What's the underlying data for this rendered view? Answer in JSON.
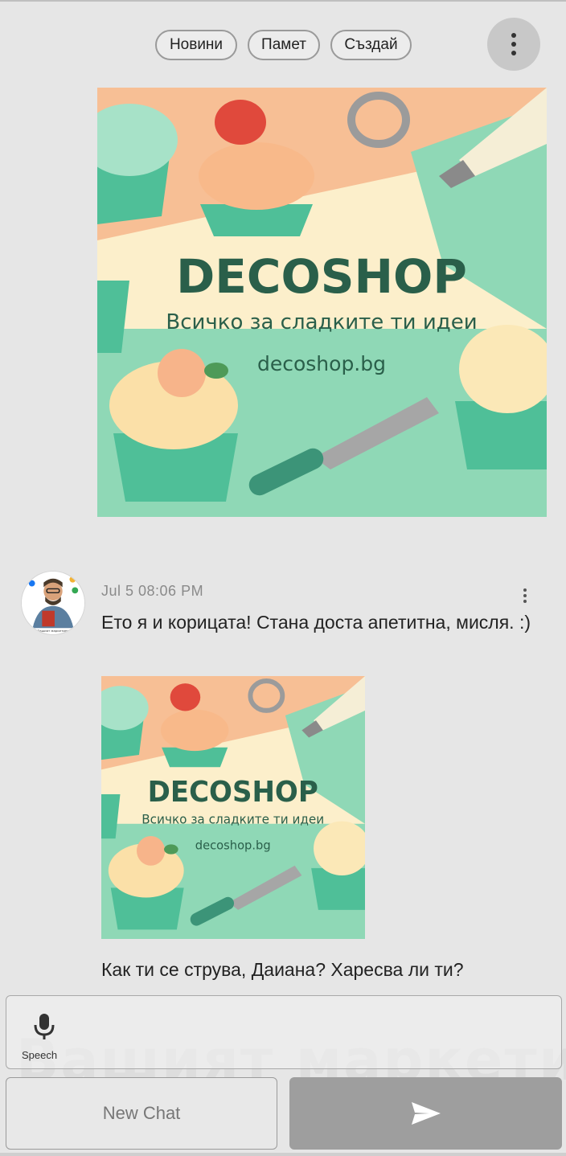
{
  "topbar": {
    "chips": [
      "Новини",
      "Памет",
      "Създай"
    ],
    "menu_icon": "more-vertical-icon"
  },
  "banner": {
    "brand": "DECOSHOP",
    "tagline": "Всичко за сладките ти идеи",
    "url": "decoshop.bg",
    "colors": {
      "peach": "#f7bf95",
      "cream": "#fcefcb",
      "mint": "#8fd8b6",
      "brand_text": "#2a5f4a"
    }
  },
  "message": {
    "timestamp": "Jul 5 08:06 PM",
    "text_1": "Ето я и корицата! Стана доста апетитна, мисля. :)",
    "text_2": "Как ти се струва, Даиана? Харесва ли ти?",
    "avatar_caption": "Вашият маркетинг"
  },
  "composer": {
    "speech_label": "Speech",
    "mic_icon": "microphone-icon"
  },
  "actions": {
    "new_chat_label": "New Chat",
    "send_icon": "send-icon"
  },
  "watermark": {
    "text": "Вашият маркетинг"
  }
}
